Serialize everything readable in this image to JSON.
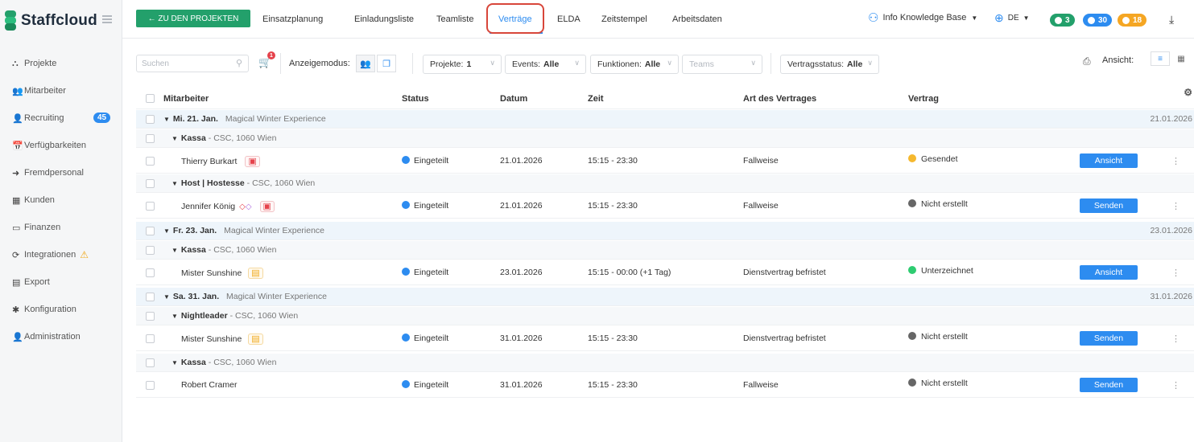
{
  "brand": {
    "name": "Staffcloud"
  },
  "sidebar": {
    "items": [
      {
        "label": "Projekte",
        "icon": "projects-icon",
        "glyph": "⛬"
      },
      {
        "label": "Mitarbeiter",
        "icon": "employees-icon",
        "glyph": "👥"
      },
      {
        "label": "Recruiting",
        "icon": "recruiting-icon",
        "glyph": "👤",
        "badge": "45"
      },
      {
        "label": "Verfügbarkeiten",
        "icon": "calendar-icon",
        "glyph": "📅"
      },
      {
        "label": "Fremdpersonal",
        "icon": "external-staff-icon",
        "glyph": "➜"
      },
      {
        "label": "Kunden",
        "icon": "building-icon",
        "glyph": "▦"
      },
      {
        "label": "Finanzen",
        "icon": "money-icon",
        "glyph": "▭"
      },
      {
        "label": "Integrationen",
        "icon": "sync-icon",
        "glyph": "⟳",
        "warning": "⚠"
      },
      {
        "label": "Export",
        "icon": "export-icon",
        "glyph": "▤"
      },
      {
        "label": "Konfiguration",
        "icon": "cog-icon",
        "glyph": "✱"
      },
      {
        "label": "Administration",
        "icon": "admin-icon",
        "glyph": "👤"
      }
    ]
  },
  "topbar": {
    "back_label": "← ZU DEN PROJEKTEN",
    "tabs": [
      "Einsatzplanung",
      "Einladungsliste",
      "Teamliste",
      "Verträge",
      "ELDA",
      "Zeitstempel",
      "Arbeitsdaten"
    ],
    "active_tab": "Verträge",
    "user_name": "Info Knowledge Base",
    "language": "DE",
    "badges": [
      {
        "value": "3",
        "color": "#23a06b"
      },
      {
        "value": "30",
        "color": "#2d8cf0"
      },
      {
        "value": "18",
        "color": "#f5a623"
      }
    ]
  },
  "filters": {
    "search_placeholder": "Suchen",
    "cart_badge": "1",
    "display_mode_label": "Anzeigemodus:",
    "projects_label": "Projekte:",
    "projects_value": "1",
    "events_label": "Events:",
    "events_value": "Alle",
    "functions_label": "Funktionen:",
    "functions_value": "Alle",
    "teams_placeholder": "Teams",
    "contract_status_label": "Vertragsstatus:",
    "contract_status_value": "Alle",
    "view_label": "Ansicht:"
  },
  "table": {
    "columns": [
      "Mitarbeiter",
      "Status",
      "Datum",
      "Zeit",
      "Art des Vertrages",
      "Vertrag"
    ],
    "groups": [
      {
        "date_label": "Mi. 21. Jan.",
        "event": "Magical Winter Experience",
        "date_right": "21.01.2026",
        "functions": [
          {
            "name": "Kassa",
            "location": "CSC, 1060 Wien",
            "rows": [
              {
                "name": "Thierry Burkart",
                "status": "Eingeteilt",
                "date": "21.01.2026",
                "time": "15:15 - 23:30",
                "type": "Fallweise",
                "contract": "Gesendet",
                "contract_color": "#f5b82e",
                "action": "Ansicht",
                "doc": "red"
              }
            ]
          },
          {
            "name": "Host | Hostesse",
            "location": "CSC, 1060 Wien",
            "rows": [
              {
                "name": "Jennifer König",
                "status": "Eingeteilt",
                "date": "21.01.2026",
                "time": "15:15 - 23:30",
                "type": "Fallweise",
                "contract": "Nicht erstellt",
                "contract_color": "#666666",
                "action": "Senden",
                "doc": "red",
                "tags": true
              }
            ]
          }
        ]
      },
      {
        "date_label": "Fr. 23. Jan.",
        "event": "Magical Winter Experience",
        "date_right": "23.01.2026",
        "functions": [
          {
            "name": "Kassa",
            "location": "CSC, 1060 Wien",
            "rows": [
              {
                "name": "Mister Sunshine",
                "status": "Eingeteilt",
                "date": "23.01.2026",
                "time": "15:15 - 00:00 (+1 Tag)",
                "type": "Dienstvertrag befristet",
                "contract": "Unterzeichnet",
                "contract_color": "#2ecc71",
                "action": "Ansicht",
                "doc": "orange"
              }
            ]
          }
        ]
      },
      {
        "date_label": "Sa. 31. Jan.",
        "event": "Magical Winter Experience",
        "date_right": "31.01.2026",
        "functions": [
          {
            "name": "Nightleader",
            "location": "CSC, 1060 Wien",
            "rows": [
              {
                "name": "Mister Sunshine",
                "status": "Eingeteilt",
                "date": "31.01.2026",
                "time": "15:15 - 23:30",
                "type": "Dienstvertrag befristet",
                "contract": "Nicht erstellt",
                "contract_color": "#666666",
                "action": "Senden",
                "doc": "orange"
              }
            ]
          },
          {
            "name": "Kassa",
            "location": "CSC, 1060 Wien",
            "rows": [
              {
                "name": "Robert Cramer",
                "status": "Eingeteilt",
                "date": "31.01.2026",
                "time": "15:15 - 23:30",
                "type": "Fallweise",
                "contract": "Nicht erstellt",
                "contract_color": "#666666",
                "action": "Senden",
                "doc": ""
              }
            ]
          }
        ]
      }
    ]
  }
}
